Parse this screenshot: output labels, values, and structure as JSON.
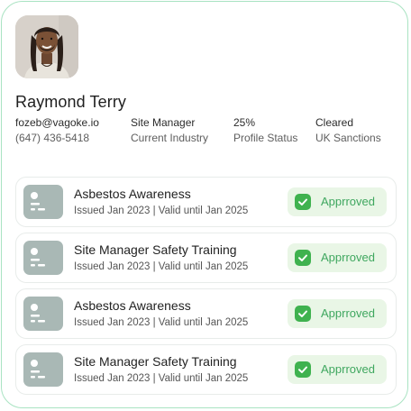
{
  "profile": {
    "name": "Raymond Terry",
    "avatar_alt": "profile photo",
    "fields": [
      {
        "value": "fozeb@vagoke.io",
        "label": "(647) 436-5418"
      },
      {
        "value": "Site Manager",
        "label": "Current Industry"
      },
      {
        "value": "25%",
        "label": "Profile Status"
      },
      {
        "value": "Cleared",
        "label": "UK Sanctions"
      }
    ]
  },
  "certificates": [
    {
      "title": "Asbestos Awareness",
      "subtitle": "Issued Jan 2023 | Valid until Jan 2025",
      "status": "Apprroved",
      "icon": "certificate-icon"
    },
    {
      "title": "Site Manager Safety Training",
      "subtitle": "Issued Jan 2023 | Valid until Jan 2025",
      "status": "Apprroved",
      "icon": "certificate-icon"
    },
    {
      "title": "Asbestos Awareness",
      "subtitle": "Issued Jan 2023 | Valid until Jan 2025",
      "status": "Apprroved",
      "icon": "certificate-icon"
    },
    {
      "title": "Site Manager Safety Training",
      "subtitle": "Issued Jan 2023 | Valid until Jan 2025",
      "status": "Apprroved",
      "icon": "certificate-icon"
    }
  ],
  "colors": {
    "card_border": "#a9e3c2",
    "badge_bg": "#e9f6e6",
    "badge_text": "#3fa75f",
    "icon_bg": "#a9b8b5"
  }
}
